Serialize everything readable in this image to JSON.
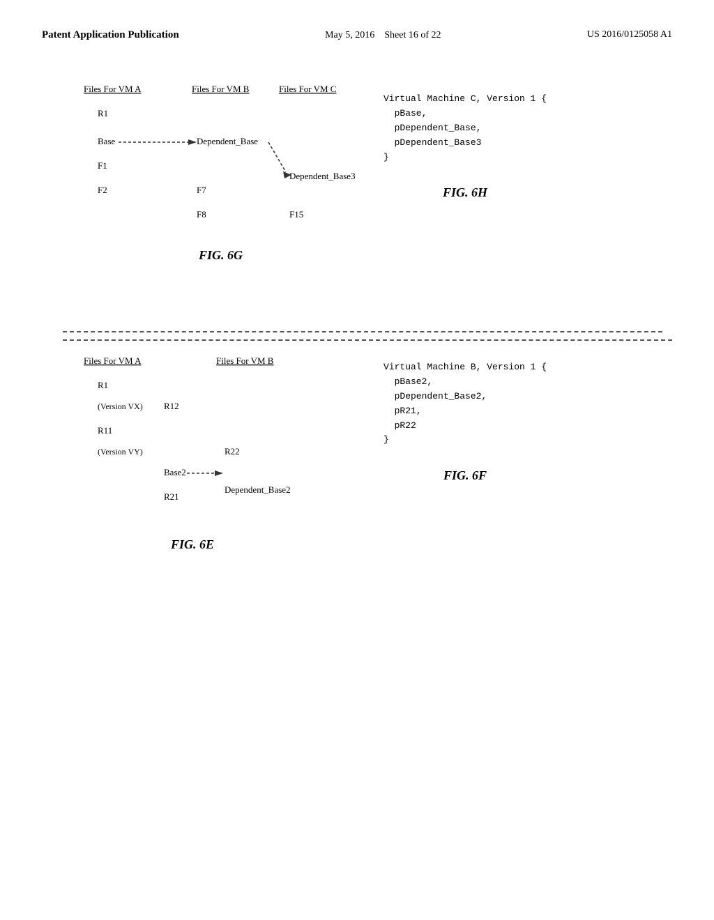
{
  "header": {
    "left_line1": "Patent Application Publication",
    "center_date": "May 5, 2016",
    "center_sheet": "Sheet 16 of 22",
    "right_patent": "US 2016/0125058 A1"
  },
  "fig6e": {
    "label": "FIG. 6E",
    "col1_header": "Files For VM A",
    "col2_header": "Files For VM B",
    "items_col1": [
      "R1",
      "(Version VX)",
      "(Version VY)",
      "R12",
      "R11",
      "Base2",
      "R21"
    ],
    "items_col2": [
      "R22",
      "Dependent_Base2"
    ],
    "arrow_label": "Base2"
  },
  "fig6f": {
    "label": "FIG. 6F",
    "code": "Virtual Machine B, Version 1 {\n  pBase2,\n  pDependent_Base2,\n  pR21,\n  pR22\n}"
  },
  "fig6g": {
    "label": "FIG. 6G",
    "col1_header": "Files For VM A",
    "col2_header": "Files For VM B",
    "col3_header": "Files For VM C",
    "items_col1": [
      "R1",
      "Base",
      "F1",
      "F2"
    ],
    "items_col2": [
      "Dependent_Base",
      "F7",
      "F8"
    ],
    "items_col3": [
      "Dependent_Base3",
      "F15"
    ]
  },
  "fig6h": {
    "label": "FIG. 6H",
    "code": "Virtual Machine C, Version 1 {\n  pBase,\n  pDependent_Base,\n  pDependent_Base3\n}"
  }
}
